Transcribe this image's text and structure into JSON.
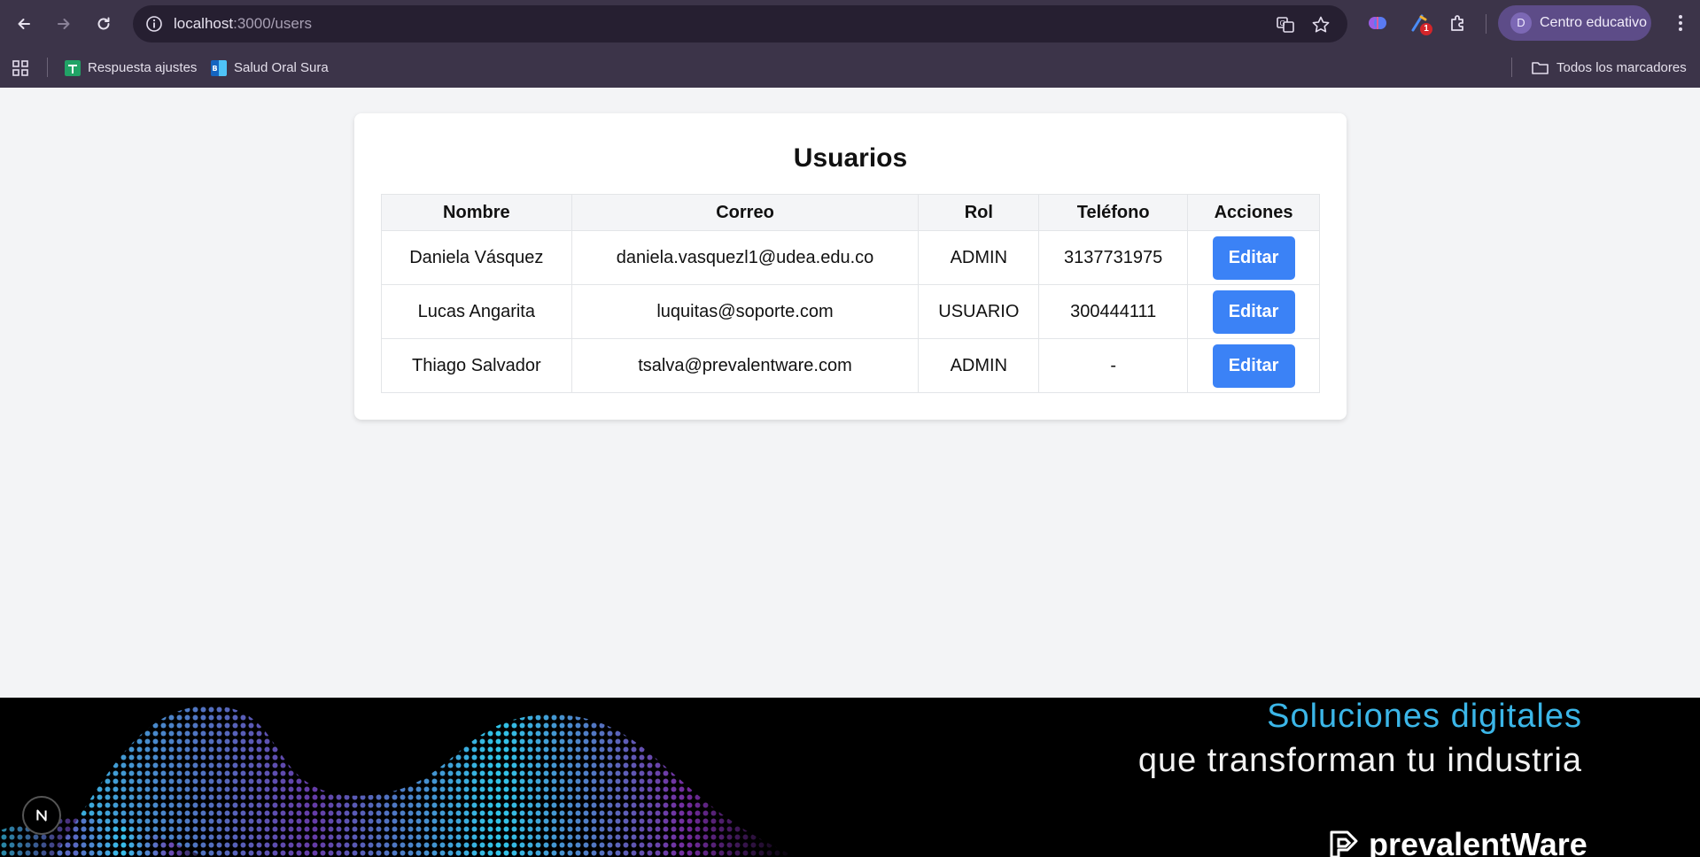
{
  "browser": {
    "url_host": "localhost",
    "url_path": ":3000/users",
    "profile_initial": "D",
    "profile_name": "Centro educativo",
    "extension_badge": "1",
    "bookmarks": [
      {
        "label": "Respuesta ajustes",
        "icon": "sheets-icon"
      },
      {
        "label": "Salud Oral Sura",
        "icon": "site-favicon"
      }
    ],
    "all_bookmarks_label": "Todos los marcadores"
  },
  "page": {
    "title": "Usuarios",
    "table": {
      "headers": [
        "Nombre",
        "Correo",
        "Rol",
        "Teléfono",
        "Acciones"
      ],
      "rows": [
        {
          "name": "Daniela Vásquez",
          "email": "daniela.vasquezl1@udea.edu.co",
          "role": "ADMIN",
          "phone": "3137731975",
          "action": "Editar"
        },
        {
          "name": "Lucas Angarita",
          "email": "luquitas@soporte.com",
          "role": "USUARIO",
          "phone": "300444111",
          "action": "Editar"
        },
        {
          "name": "Thiago Salvador",
          "email": "tsalva@prevalentware.com",
          "role": "ADMIN",
          "phone": "-",
          "action": "Editar"
        }
      ]
    }
  },
  "banner": {
    "tagline_1": "Soluciones digitales",
    "tagline_2": "que transforman tu industria",
    "brand": "prevalentWare"
  },
  "dev_badge": "N",
  "colors": {
    "accent_button": "#3b82f6",
    "tagline_accent": "#3bb6e8",
    "chrome_bg": "#3c3449"
  }
}
